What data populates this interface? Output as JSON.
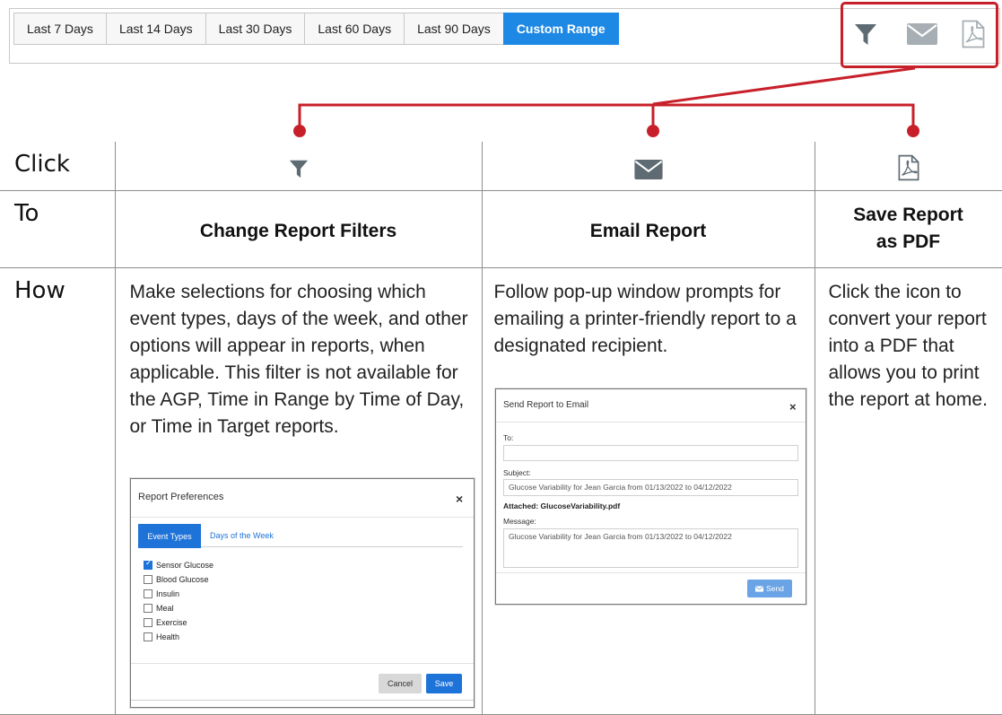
{
  "toolbar": {
    "ranges": [
      "Last 7 Days",
      "Last 14 Days",
      "Last 30 Days",
      "Last 60 Days",
      "Last 90 Days",
      "Custom Range"
    ],
    "active_range": "Custom Range",
    "icons": [
      "filter-icon",
      "envelope-icon",
      "pdf-icon"
    ]
  },
  "colors": {
    "accent": "#1e88e5",
    "callout": "#c8202a",
    "icon_gray": "#5f6b73",
    "icon_light": "#a7afb4",
    "save_blue": "#1e73d8"
  },
  "table": {
    "row_labels": {
      "click": "Click",
      "to": "To",
      "how": "How"
    },
    "columns": [
      {
        "icon": "filter-icon",
        "to": "Change Report Filters",
        "how": "Make selections for choosing which event types, days of the week, and other options will appear in reports, when applicable. This filter is not available for the AGP, Time in Range by Time of Day, or Time in Target reports."
      },
      {
        "icon": "envelope-icon",
        "to": "Email Report",
        "how": "Follow pop-up window prompts for emailing a printer-friendly report to a designated recipient."
      },
      {
        "icon": "pdf-icon",
        "to": "Save Report as PDF",
        "how": "Click the icon to convert your report into a PDF that allows you to print the report at home."
      }
    ]
  },
  "prefs_modal": {
    "title": "Report Preferences",
    "close": "×",
    "tabs": [
      "Event Types",
      "Days of the Week"
    ],
    "active_tab": "Event Types",
    "options": [
      {
        "label": "Sensor Glucose",
        "checked": true
      },
      {
        "label": "Blood Glucose",
        "checked": false
      },
      {
        "label": "Insulin",
        "checked": false
      },
      {
        "label": "Meal",
        "checked": false
      },
      {
        "label": "Exercise",
        "checked": false
      },
      {
        "label": "Health",
        "checked": false
      }
    ],
    "cancel": "Cancel",
    "save": "Save"
  },
  "email_modal": {
    "title": "Send Report to Email",
    "close": "×",
    "to_label": "To:",
    "to_value": "",
    "subject_label": "Subject:",
    "subject_value": "Glucose Variability for Jean Garcia from 01/13/2022 to 04/12/2022",
    "attached": "Attached: GlucoseVariability.pdf",
    "message_label": "Message:",
    "message_value": "Glucose Variability for Jean Garcia from 01/13/2022 to 04/12/2022",
    "send": "Send"
  }
}
